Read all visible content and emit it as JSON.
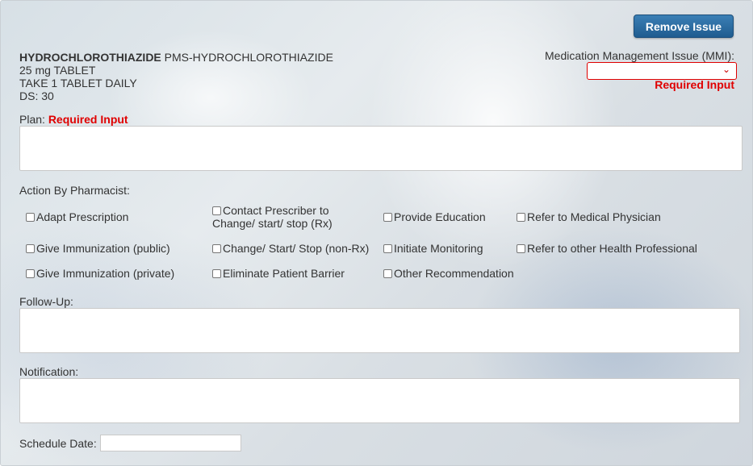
{
  "header": {
    "remove_button": "Remove Issue"
  },
  "drug": {
    "name": "HYDROCHLOROTHIAZIDE",
    "brand": "PMS-HYDROCHLOROTHIAZIDE",
    "strength": "25 mg TABLET",
    "directions": "TAKE 1 TABLET DAILY",
    "days_supply": "DS: 30"
  },
  "mmi": {
    "label": "Medication Management Issue (MMI):",
    "value": "",
    "required": "Required Input"
  },
  "plan": {
    "label": "Plan:",
    "required": "Required Input",
    "value": ""
  },
  "actions": {
    "label": "Action By Pharmacist:",
    "items": [
      {
        "label": "Adapt Prescription",
        "checked": false
      },
      {
        "label": "Contact Prescriber to",
        "label2": "Change/ start/ stop (Rx)",
        "checked": false
      },
      {
        "label": "Provide Education",
        "checked": false
      },
      {
        "label": "Refer to Medical Physician",
        "checked": false
      },
      {
        "label": "Give Immunization (public)",
        "checked": false
      },
      {
        "label": "Change/ Start/ Stop (non-Rx)",
        "checked": false
      },
      {
        "label": "Initiate Monitoring",
        "checked": false
      },
      {
        "label": "Refer to other Health Professional",
        "checked": false
      },
      {
        "label": "Give Immunization (private)",
        "checked": false
      },
      {
        "label": "Eliminate Patient Barrier",
        "checked": false
      },
      {
        "label": "Other Recommendation",
        "checked": false
      }
    ]
  },
  "followup": {
    "label": "Follow-Up:",
    "value": ""
  },
  "notification": {
    "label": "Notification:",
    "value": ""
  },
  "schedule": {
    "label": "Schedule Date:",
    "value": ""
  },
  "colors": {
    "accent": "#2a6ca3",
    "required": "#e00000"
  }
}
